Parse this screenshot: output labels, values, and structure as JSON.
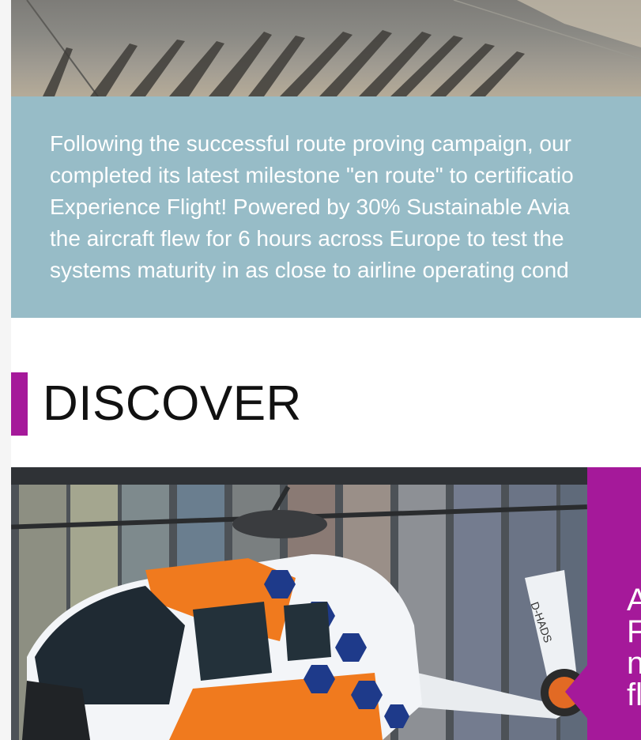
{
  "info_box": {
    "lines": [
      "Following the successful route proving campaign, our",
      "completed its latest milestone \"en route\" to certificatio",
      "Experience Flight! Powered by 30% Sustainable Avia",
      "the aircraft flew for 6 hours across Europe to test the",
      "systems maturity in as close to airline operating cond"
    ]
  },
  "discover": {
    "title": "DISCOVER"
  },
  "feature": {
    "registration": "D-HADS",
    "panel_lines": [
      "A",
      "F",
      "n",
      "fl"
    ]
  },
  "colors": {
    "accent": "#a5199a",
    "info_box_bg": "#97bcc7"
  }
}
